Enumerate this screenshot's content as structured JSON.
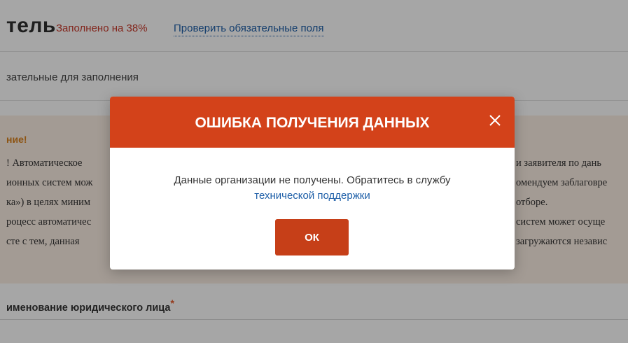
{
  "header": {
    "title": "тель",
    "fill_status": "Заполнено на 38%",
    "check_required_link": "Проверить обязательные поля"
  },
  "required_note": "зательные для заполнения",
  "warning": {
    "title": "ние!",
    "left_lines": [
      "!  Автоматическое",
      "ионных систем мож",
      "ка») в целях миним",
      "роцесс автоматичес",
      "сте с тем, данная"
    ],
    "right_lines": [
      "и заявителя по дань",
      "омендуем заблаговре",
      "отборе.",
      "систем может осуще",
      "загружаются независ"
    ]
  },
  "field": {
    "label": "именование юридического лица",
    "required_mark": "*"
  },
  "modal": {
    "title": "ОШИБКА ПОЛУЧЕНИЯ ДАННЫХ",
    "message": "Данные организации не получены. Обратитесь в службу",
    "support_link": "технической поддержки",
    "ok_label": "ОК",
    "close_icon": "close-icon"
  },
  "colors": {
    "modal_header": "#d3421a",
    "ok_button": "#c63f18",
    "link": "#1e5fa8",
    "status_red": "#c8392b",
    "warning_bg": "#fbeee3",
    "warning_title": "#d9821e"
  }
}
